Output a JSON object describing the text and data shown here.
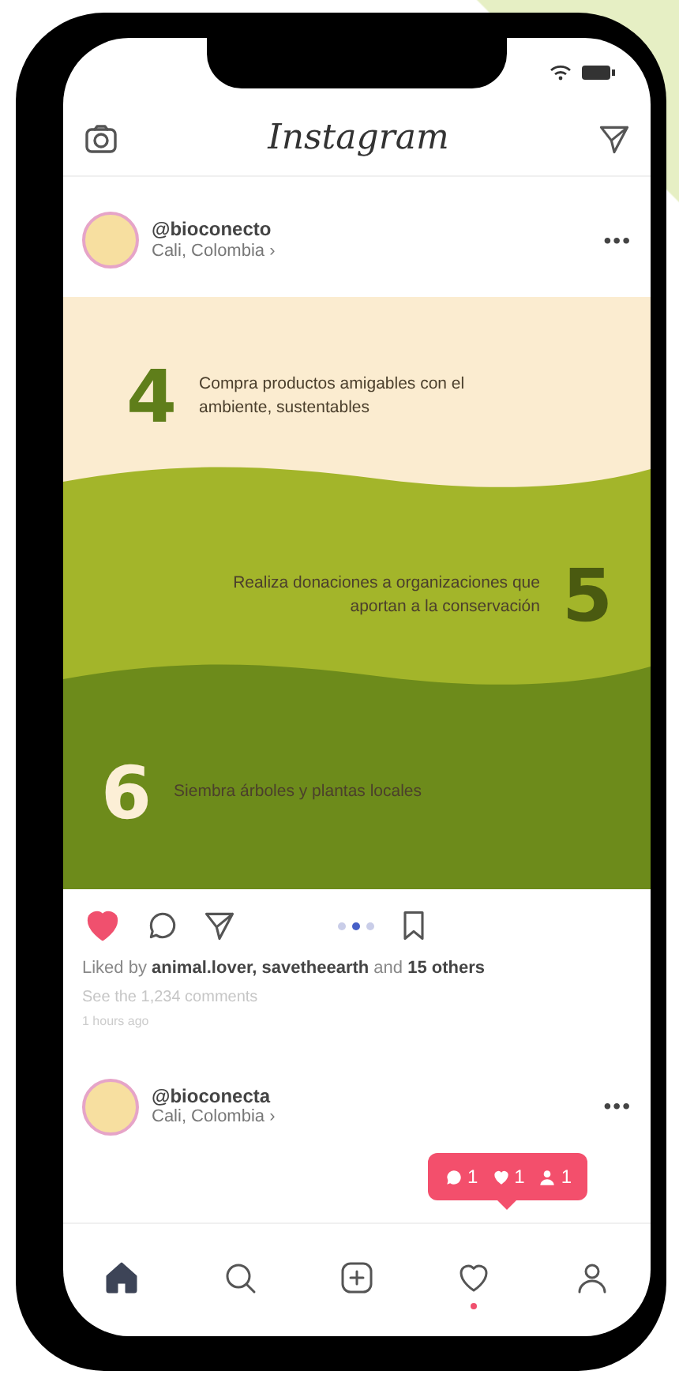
{
  "app_bar": {
    "title": "Instagram"
  },
  "posts": [
    {
      "username": "@bioconecto",
      "location": "Cali, Colombia ›",
      "more": "•••",
      "image": {
        "steps": [
          {
            "number": "4",
            "text": "Compra productos amigables con el ambiente, sustentables",
            "kind": "start"
          },
          {
            "number": "5",
            "text": "Realiza donaciones a organizaciones que aportan a la conservación",
            "kind": "end"
          },
          {
            "number": "6",
            "text": "Siembra árboles y plantas locales",
            "kind": "start"
          }
        ]
      },
      "liked": true,
      "carousel": [
        {
          "selected": false
        },
        {
          "selected": true
        },
        {
          "selected": false
        }
      ],
      "likes": "Liked by **animal.lover, savetheearth** and **15 others**",
      "comments": "See the 1,234 comments",
      "time": "1 hours ago"
    },
    {
      "username": "@bioconecta",
      "location": "Cali, Colombia ›",
      "more": "•••"
    }
  ],
  "notification": [
    {
      "kind": "comment",
      "count": "1"
    },
    {
      "kind": "like",
      "count": "1"
    },
    {
      "kind": "follower",
      "count": "1"
    }
  ],
  "tab_bar": [
    {
      "kind": "home",
      "selected": true,
      "unread": false
    },
    {
      "kind": "search",
      "selected": false,
      "unread": false
    },
    {
      "kind": "add",
      "selected": false,
      "unread": false
    },
    {
      "kind": "activity",
      "selected": false,
      "unread": true
    },
    {
      "kind": "profile",
      "selected": false,
      "unread": false
    }
  ]
}
